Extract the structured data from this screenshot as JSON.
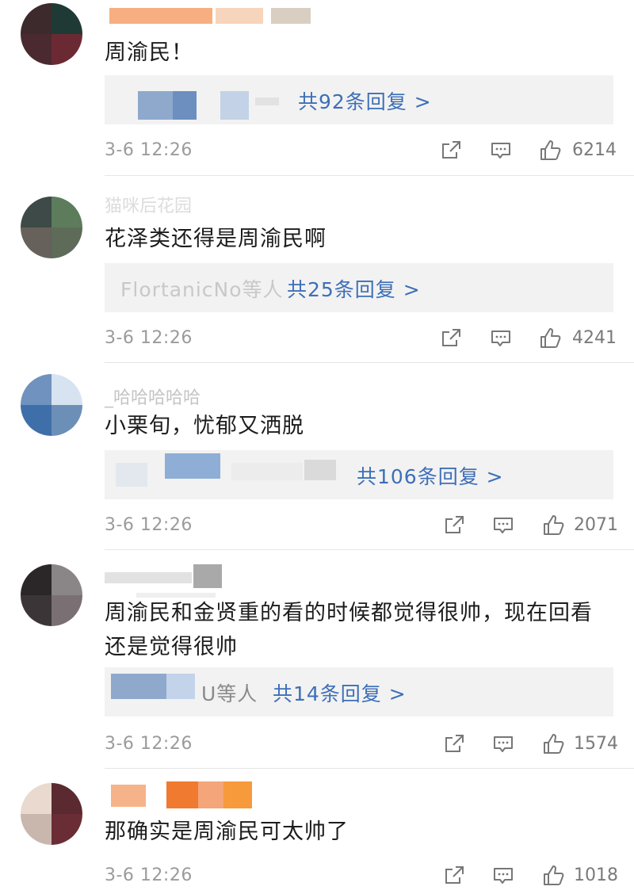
{
  "comments": [
    {
      "text": "周渝民！",
      "reply_names": "",
      "reply_link": "共92条回复 >",
      "time": "3-6 12:26",
      "likes": "6214"
    },
    {
      "username": "猫咪后花园",
      "text": "花泽类还得是周渝民啊",
      "reply_names": "FlortanicNo等人",
      "reply_link": "共25条回复 >",
      "time": "3-6 12:26",
      "likes": "4241"
    },
    {
      "username": "_哈哈哈哈哈",
      "text": "小栗旬，忧郁又洒脱",
      "reply_names": "",
      "reply_link": "共106条回复 >",
      "time": "3-6 12:26",
      "likes": "2071"
    },
    {
      "text": "周渝民和金贤重的看的时候都觉得很帅，现在回看还是觉得很帅",
      "reply_names": "U等人",
      "reply_link": "共14条回复 >",
      "time": "3-6 12:26",
      "likes": "1574"
    },
    {
      "text": "那确实是周渝民可太帅了",
      "time": "3-6 12:26",
      "likes": "1018"
    }
  ],
  "icons": [
    "share-icon",
    "comment-icon",
    "like-icon"
  ],
  "colors": {
    "link": "#3d6fb7",
    "reply_bg": "#f2f2f2",
    "meta": "#9b9b9b"
  }
}
